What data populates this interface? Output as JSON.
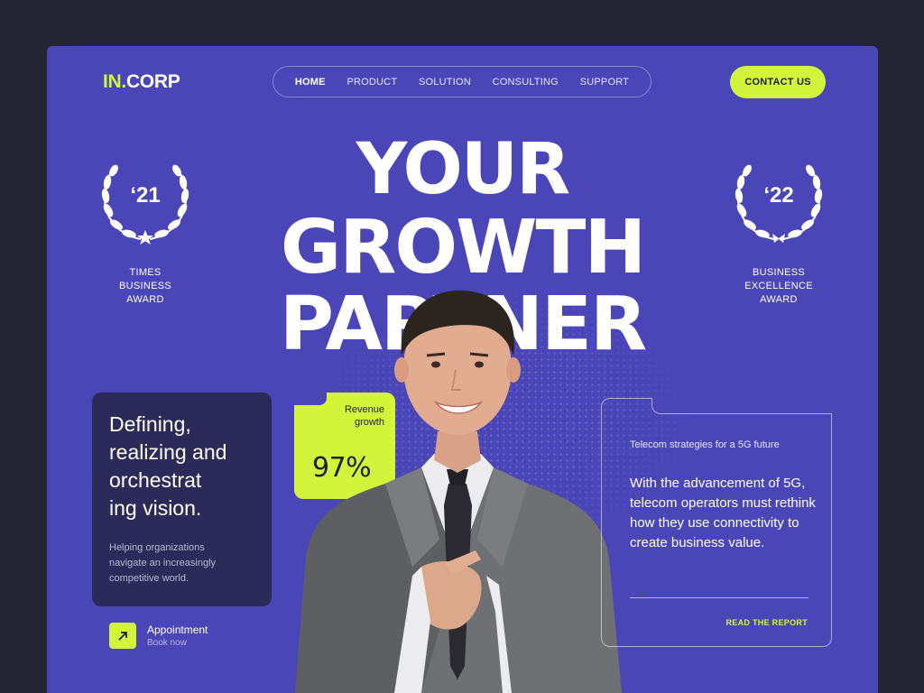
{
  "header": {
    "logo_prefix": "IN.",
    "logo_suffix": "CORP",
    "nav": [
      "HOME",
      "PRODUCT",
      "SOLUTION",
      "CONSULTING",
      "SUPPORT"
    ],
    "active_nav": "HOME",
    "contact_label": "CONTACT US"
  },
  "hero": {
    "line1": "YOUR",
    "line2": "GROWTH",
    "line3": "PARTNER"
  },
  "awards": [
    {
      "year": "‘21",
      "label_lines": [
        "TIMES",
        "BUSINESS",
        "AWARD"
      ]
    },
    {
      "year": "‘22",
      "label_lines": [
        "BUSINESS",
        "EXCELLENCE",
        "AWARD"
      ]
    }
  ],
  "intro_card": {
    "heading_lines": [
      "Defining,",
      "realizing and",
      "orchestrat",
      "ing vision."
    ],
    "body_lines": [
      "Helping organizations",
      "navigate an increasingly",
      "competitive world."
    ]
  },
  "appointment": {
    "title": "Appointment",
    "subtitle": "Book now"
  },
  "revenue_card": {
    "label_lines": [
      "Revenue",
      "growth"
    ],
    "value": "97%"
  },
  "report_card": {
    "kicker": "Telecom strategies for a 5G future",
    "body": "With the advancement of 5G, telecom operators must rethink how they use connectivity to create business value.",
    "link": "READ THE REPORT"
  },
  "colors": {
    "background": "#252433",
    "brand_purple": "#4a46b8",
    "accent_lime": "#d2f53c",
    "card_dark": "#2b2a58"
  }
}
